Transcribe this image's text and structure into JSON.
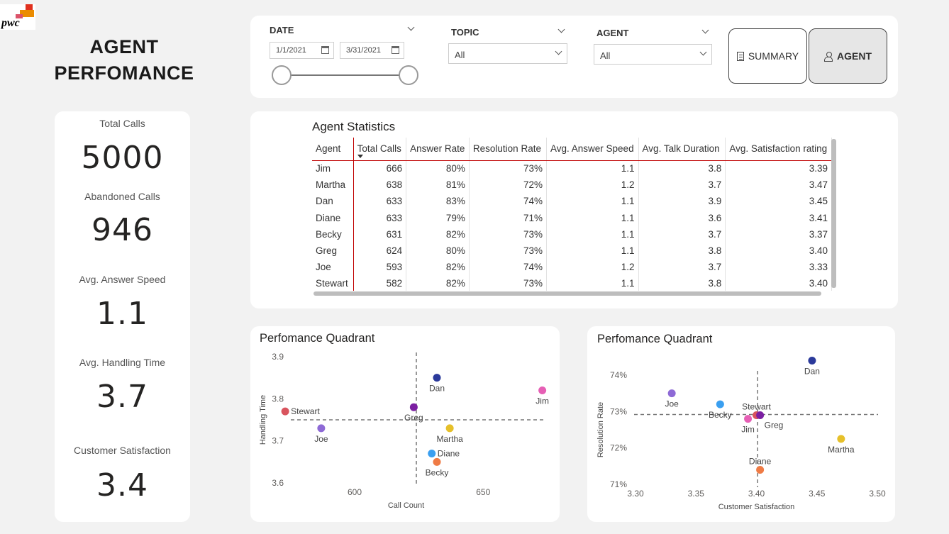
{
  "brand": {
    "logo_text": "pwc"
  },
  "page": {
    "title_line1": "AGENT",
    "title_line2": "PERFOMANCE"
  },
  "kpis": {
    "total_calls_label": "Total Calls",
    "total_calls_value": "5000",
    "abandoned_label": "Abandoned Calls",
    "abandoned_value": "946",
    "answer_speed_label": "Avg. Answer Speed",
    "answer_speed_value": "1.1",
    "handling_label": "Avg. Handling Time",
    "handling_value": "3.7",
    "satisfaction_label": "Customer Satisfaction",
    "satisfaction_value": "3.4"
  },
  "filters": {
    "date_label": "DATE",
    "date_start": "1/1/2021",
    "date_end": "3/31/2021",
    "topic_label": "TOPIC",
    "topic_value": "All",
    "agent_label": "AGENT",
    "agent_value": "All"
  },
  "nav": {
    "summary_label": "SUMMARY",
    "agent_label": "AGENT"
  },
  "table": {
    "title": "Agent Statistics",
    "columns": [
      "Agent",
      "Total Calls",
      "Answer Rate",
      "Resolution Rate",
      "Avg. Answer Speed",
      "Avg. Talk Duration",
      "Avg. Satisfaction rating"
    ],
    "rows": [
      [
        "Jim",
        "666",
        "80%",
        "73%",
        "1.1",
        "3.8",
        "3.39"
      ],
      [
        "Martha",
        "638",
        "81%",
        "72%",
        "1.2",
        "3.7",
        "3.47"
      ],
      [
        "Dan",
        "633",
        "83%",
        "74%",
        "1.1",
        "3.9",
        "3.45"
      ],
      [
        "Diane",
        "633",
        "79%",
        "71%",
        "1.1",
        "3.6",
        "3.41"
      ],
      [
        "Becky",
        "631",
        "82%",
        "73%",
        "1.1",
        "3.7",
        "3.37"
      ],
      [
        "Greg",
        "624",
        "80%",
        "73%",
        "1.1",
        "3.8",
        "3.40"
      ],
      [
        "Joe",
        "593",
        "82%",
        "74%",
        "1.2",
        "3.7",
        "3.33"
      ],
      [
        "Stewart",
        "582",
        "82%",
        "73%",
        "1.1",
        "3.8",
        "3.40"
      ]
    ]
  },
  "chart_data": [
    {
      "type": "scatter",
      "title": "Perfomance Quadrant",
      "xlabel": "Call Count",
      "ylabel": "Handling Time",
      "xlim": [
        576,
        664
      ],
      "ylim": [
        3.6,
        3.9
      ],
      "x_ticks": [
        "600",
        "650"
      ],
      "x_tick_values": [
        600,
        650
      ],
      "y_ticks": [
        "3.9",
        "3.8",
        "3.7",
        "3.6"
      ],
      "y_tick_values": [
        3.9,
        3.8,
        3.7,
        3.6
      ],
      "ref_x": 624,
      "ref_y": 3.75,
      "points": [
        {
          "label": "Dan",
          "x": 632,
          "y": 3.85,
          "color": "#2b3a9b",
          "label_pos": "below"
        },
        {
          "label": "Jim",
          "x": 673,
          "y": 3.82,
          "color": "#e65fb5",
          "label_pos": "below"
        },
        {
          "label": "Stewart",
          "x": 573,
          "y": 3.77,
          "color": "#d9545e",
          "label_pos": "right"
        },
        {
          "label": "Greg",
          "x": 623,
          "y": 3.78,
          "color": "#7b1fa2",
          "label_pos": "below"
        },
        {
          "label": "Joe",
          "x": 587,
          "y": 3.73,
          "color": "#8e6ad6",
          "label_pos": "below"
        },
        {
          "label": "Martha",
          "x": 637,
          "y": 3.73,
          "color": "#e6c02a",
          "label_pos": "below"
        },
        {
          "label": "Diane",
          "x": 630,
          "y": 3.67,
          "color": "#3a9ff0",
          "label_pos": "right"
        },
        {
          "label": "Becky",
          "x": 632,
          "y": 3.65,
          "color": "#ef7b45",
          "label_pos": "below"
        }
      ]
    },
    {
      "type": "scatter",
      "title": "Perfomance Quadrant",
      "xlabel": "Customer Satisfaction",
      "ylabel": "Resolution Rate",
      "xlim": [
        3.3,
        3.5
      ],
      "ylim": [
        71,
        74
      ],
      "x_ticks": [
        "3.30",
        "3.35",
        "3.40",
        "3.45",
        "3.50"
      ],
      "x_tick_values": [
        3.3,
        3.35,
        3.4,
        3.45,
        3.5
      ],
      "y_ticks": [
        "74%",
        "73%",
        "72%",
        "71%"
      ],
      "y_tick_values": [
        74,
        73,
        72,
        71
      ],
      "ref_x": 3.401,
      "ref_y": 72.92,
      "points": [
        {
          "label": "Dan",
          "x": 3.446,
          "y": 74.4,
          "color": "#2b3a9b",
          "label_pos": "below"
        },
        {
          "label": "Joe",
          "x": 3.33,
          "y": 73.5,
          "color": "#8e6ad6",
          "label_pos": "below"
        },
        {
          "label": "Becky",
          "x": 3.37,
          "y": 73.2,
          "color": "#3a9ff0",
          "label_pos": "below"
        },
        {
          "label": "Stewart",
          "x": 3.4,
          "y": 72.9,
          "color": "#d9545e",
          "label_pos": "above"
        },
        {
          "label": "Jim",
          "x": 3.393,
          "y": 72.8,
          "color": "#e65fb5",
          "label_pos": "below"
        },
        {
          "label": "Greg",
          "x": 3.403,
          "y": 72.9,
          "color": "#7b1fa2",
          "label_pos": "below-right"
        },
        {
          "label": "Martha",
          "x": 3.47,
          "y": 72.25,
          "color": "#e6c02a",
          "label_pos": "below"
        },
        {
          "label": "Diane",
          "x": 3.403,
          "y": 71.4,
          "color": "#ef7b45",
          "label_pos": "above"
        }
      ]
    }
  ]
}
